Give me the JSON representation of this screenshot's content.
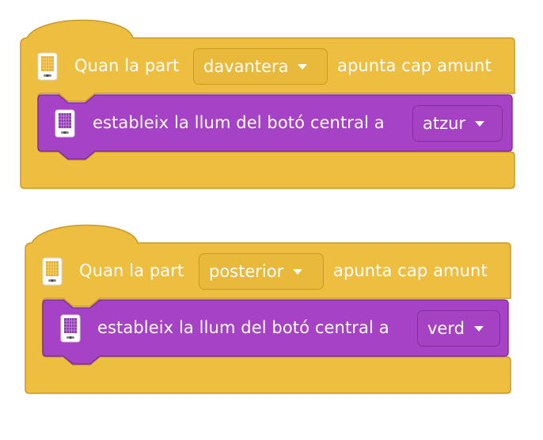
{
  "colors": {
    "event_fill": "#edbe40",
    "event_stroke": "#c99a26",
    "action_fill": "#a642c5",
    "action_stroke": "#80309a",
    "text": "#ffffff"
  },
  "blocks": [
    {
      "event": {
        "icon": "hub-front-icon",
        "prefix": "Quan la part",
        "dropdown": "davantera",
        "suffix": "apunta cap amunt"
      },
      "action": {
        "icon": "hub-light-matrix-icon",
        "label": "estableix la llum del botó central a",
        "dropdown": "atzur"
      }
    },
    {
      "event": {
        "icon": "hub-back-icon",
        "prefix": "Quan la part",
        "dropdown": "posterior",
        "suffix": "apunta cap amunt"
      },
      "action": {
        "icon": "hub-light-matrix-icon",
        "label": "estableix la llum del botó central a",
        "dropdown": "verd"
      }
    }
  ]
}
